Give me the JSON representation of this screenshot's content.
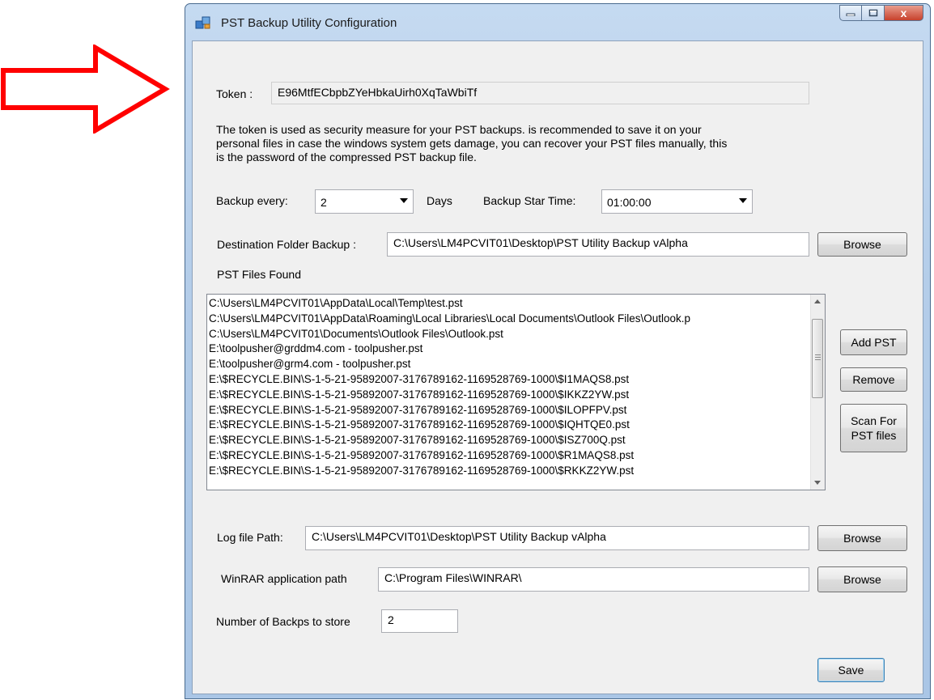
{
  "window": {
    "title": "PST Backup Utility Configuration",
    "close_glyph": "x"
  },
  "token": {
    "label": "Token :",
    "value": "E96MtfECbpbZYeHbkaUirh0XqTaWbiTf"
  },
  "info_text": [
    "The token is used as security measure for your PST backups. is recommended to save it on your",
    "personal files in case the windows system gets damage, you can recover your PST files manually, this",
    "is the password of the compressed PST backup file."
  ],
  "schedule": {
    "backup_every_label": "Backup every:",
    "backup_every_value": "2",
    "days_label": "Days",
    "start_time_label": "Backup Star Time:",
    "start_time_value": "01:00:00"
  },
  "destination": {
    "label": "Destination Folder Backup :",
    "value": "C:\\Users\\LM4PCVIT01\\Desktop\\PST Utility Backup vAlpha",
    "browse_label": "Browse"
  },
  "pst_files": {
    "label": "PST Files Found",
    "items": [
      "C:\\Users\\LM4PCVIT01\\AppData\\Local\\Temp\\test.pst",
      "C:\\Users\\LM4PCVIT01\\AppData\\Roaming\\Local Libraries\\Local Documents\\Outlook Files\\Outlook.p",
      "C:\\Users\\LM4PCVIT01\\Documents\\Outlook Files\\Outlook.pst",
      "E:\\toolpusher@grddm4.com - toolpusher.pst",
      "E:\\toolpusher@grm4.com - toolpusher.pst",
      "E:\\$RECYCLE.BIN\\S-1-5-21-95892007-3176789162-1169528769-1000\\$I1MAQS8.pst",
      "E:\\$RECYCLE.BIN\\S-1-5-21-95892007-3176789162-1169528769-1000\\$IKKZ2YW.pst",
      "E:\\$RECYCLE.BIN\\S-1-5-21-95892007-3176789162-1169528769-1000\\$ILOPFPV.pst",
      "E:\\$RECYCLE.BIN\\S-1-5-21-95892007-3176789162-1169528769-1000\\$IQHTQE0.pst",
      "E:\\$RECYCLE.BIN\\S-1-5-21-95892007-3176789162-1169528769-1000\\$ISZ700Q.pst",
      "E:\\$RECYCLE.BIN\\S-1-5-21-95892007-3176789162-1169528769-1000\\$R1MAQS8.pst",
      "E:\\$RECYCLE.BIN\\S-1-5-21-95892007-3176789162-1169528769-1000\\$RKKZ2YW.pst"
    ],
    "add_label": "Add PST",
    "remove_label": "Remove",
    "scan_label_line1": "Scan For",
    "scan_label_line2": "PST files"
  },
  "log_file": {
    "label": "Log file Path:",
    "value": "C:\\Users\\LM4PCVIT01\\Desktop\\PST Utility Backup vAlpha",
    "browse_label": "Browse"
  },
  "winrar": {
    "label": "WinRAR application path",
    "value": "C:\\Program Files\\WINRAR\\",
    "browse_label": "Browse"
  },
  "backups_to_store": {
    "label": "Number of Backps to store",
    "value": "2"
  },
  "save_label": "Save",
  "colors": {
    "arrow": "#ff0000",
    "window_frame": "#aac6e6",
    "close_button": "#c7412c",
    "client": "#f0f0f0"
  }
}
